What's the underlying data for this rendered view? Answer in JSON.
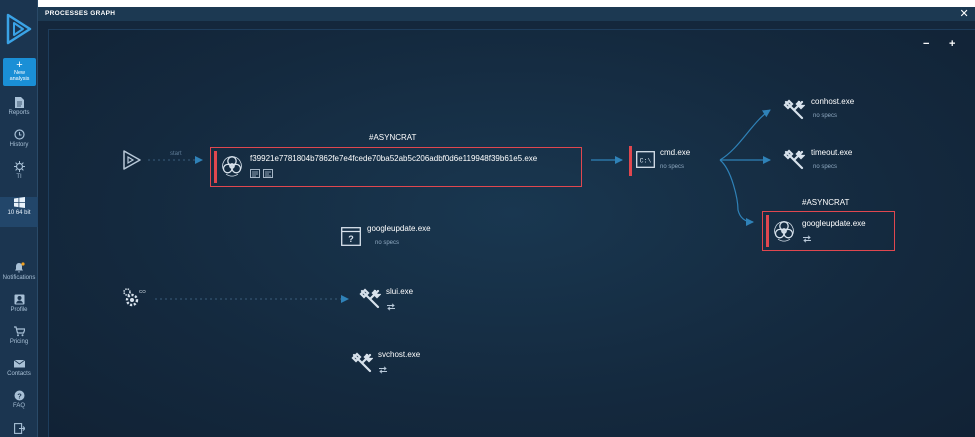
{
  "sidebar": {
    "new_analysis": {
      "plus": "+",
      "line1": "New",
      "line2": "analysis"
    },
    "items": [
      {
        "label": "Reports"
      },
      {
        "label": "History"
      },
      {
        "label": "TI"
      },
      {
        "label": "10 64 bit"
      },
      {
        "label": "Notifications"
      },
      {
        "label": "Profile"
      },
      {
        "label": "Pricing"
      },
      {
        "label": "Contacts"
      },
      {
        "label": "FAQ"
      }
    ]
  },
  "header": {
    "title": "PROCESSES GRAPH",
    "close": "✕"
  },
  "zoom": {
    "minus": "−",
    "plus": "+"
  },
  "graph": {
    "start_label": "start",
    "nodes": {
      "main": {
        "tag": "#ASYNCRAT",
        "name": "f39921e7781804b7862fe7e4fcede70ba52ab5c206adbf0d6e119948f39b61e5.exe"
      },
      "cmd": {
        "name": "cmd.exe",
        "specs": "no specs"
      },
      "conhost": {
        "name": "conhost.exe",
        "specs": "no specs"
      },
      "timeout": {
        "name": "timeout.exe",
        "specs": "no specs"
      },
      "googleupdate2": {
        "tag": "#ASYNCRAT",
        "name": "googleupdate.exe"
      },
      "googleupdate1": {
        "name": "googleupdate.exe",
        "specs": "no specs"
      },
      "slui": {
        "name": "slui.exe"
      },
      "svchost": {
        "name": "svchost.exe"
      }
    }
  },
  "colors": {
    "accent": "#1a8fd6",
    "alert": "#e0474f",
    "background": "#14293e",
    "sidebar": "#1b3550",
    "edge": "#2f82b8"
  }
}
